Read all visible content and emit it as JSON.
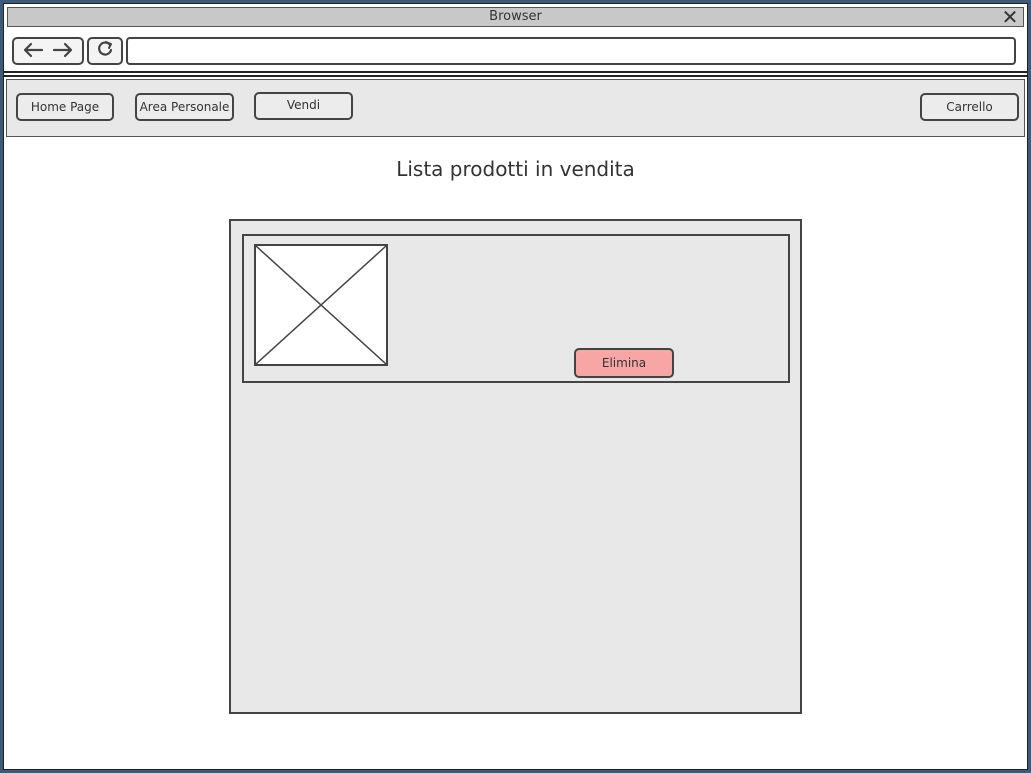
{
  "window": {
    "title": "Browser"
  },
  "toolbar": {
    "address_value": ""
  },
  "menu": {
    "home_label": "Home Page",
    "area_label": "Area Personale",
    "vendi_label": "Vendi",
    "cart_label": "Carrello"
  },
  "main": {
    "title": "Lista prodotti in vendita",
    "products": [
      {
        "delete_label": "Elimina"
      }
    ]
  },
  "icons": {
    "back": "back-arrow-icon",
    "forward": "forward-arrow-icon",
    "refresh": "refresh-icon",
    "close": "close-icon",
    "image": "image-placeholder-icon"
  },
  "colors": {
    "delete_button": "#f7a5a5",
    "panel": "#e8e8e8",
    "titlebar": "#c8c8c8"
  }
}
